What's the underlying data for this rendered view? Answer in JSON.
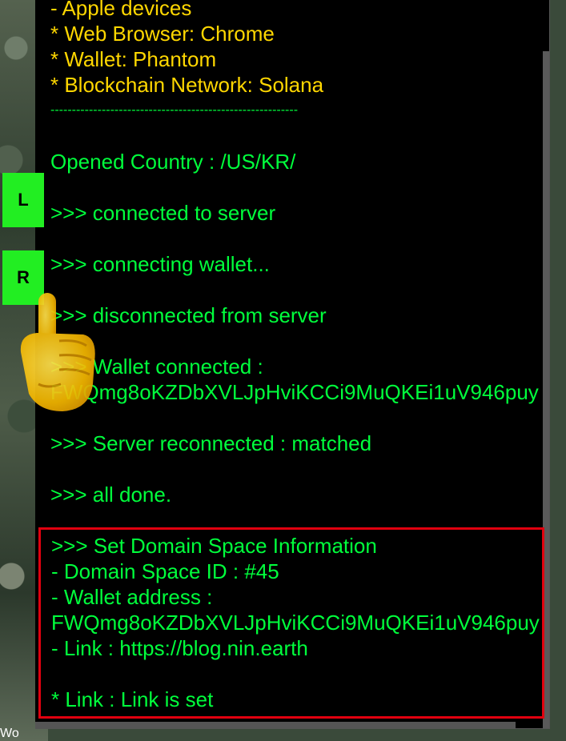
{
  "map": {
    "bottom_text": "Wo"
  },
  "side_buttons": {
    "left_label": "L",
    "right_label": "R"
  },
  "terminal": {
    "lines": [
      {
        "text": "  - Apple devices",
        "color": "yellow"
      },
      {
        "text": "* Web Browser: Chrome",
        "color": "yellow"
      },
      {
        "text": "* Wallet: Phantom",
        "color": "yellow"
      },
      {
        "text": "* Blockchain Network: Solana",
        "color": "yellow"
      },
      {
        "text": "----------------------------------------------------------",
        "color": "green"
      },
      {
        "text": "",
        "color": "green"
      },
      {
        "text": "Opened Country : /US/KR/",
        "color": "green"
      },
      {
        "text": "",
        "color": "green"
      },
      {
        "text": ">>> connected to server",
        "color": "green"
      },
      {
        "text": "",
        "color": "green"
      },
      {
        "text": ">>> connecting wallet...",
        "color": "green"
      },
      {
        "text": "",
        "color": "green"
      },
      {
        "text": ">>> disconnected from server",
        "color": "green"
      },
      {
        "text": "",
        "color": "green"
      },
      {
        "text": ">>> Wallet connected :",
        "color": "green"
      },
      {
        "text": "FWQmg8oKZDbXVLJpHviKCCi9MuQKEi1uV946puy",
        "color": "green"
      },
      {
        "text": "",
        "color": "green"
      },
      {
        "text": ">>> Server reconnected : matched",
        "color": "green"
      },
      {
        "text": "",
        "color": "green"
      },
      {
        "text": ">>> all done.",
        "color": "green"
      }
    ]
  },
  "domain_panel": {
    "lines": [
      ">>> Set Domain Space Information",
      "- Domain Space ID : #45",
      "- Wallet address :",
      "FWQmg8oKZDbXVLJpHviKCCi9MuQKEi1uV946puy",
      "- Link : https://blog.nin.earth",
      "",
      "* Link : Link is set"
    ],
    "border_color": "#e1000f"
  },
  "colors": {
    "yellow": "#ffd700",
    "green": "#00ff3c",
    "button": "#22ee22"
  }
}
